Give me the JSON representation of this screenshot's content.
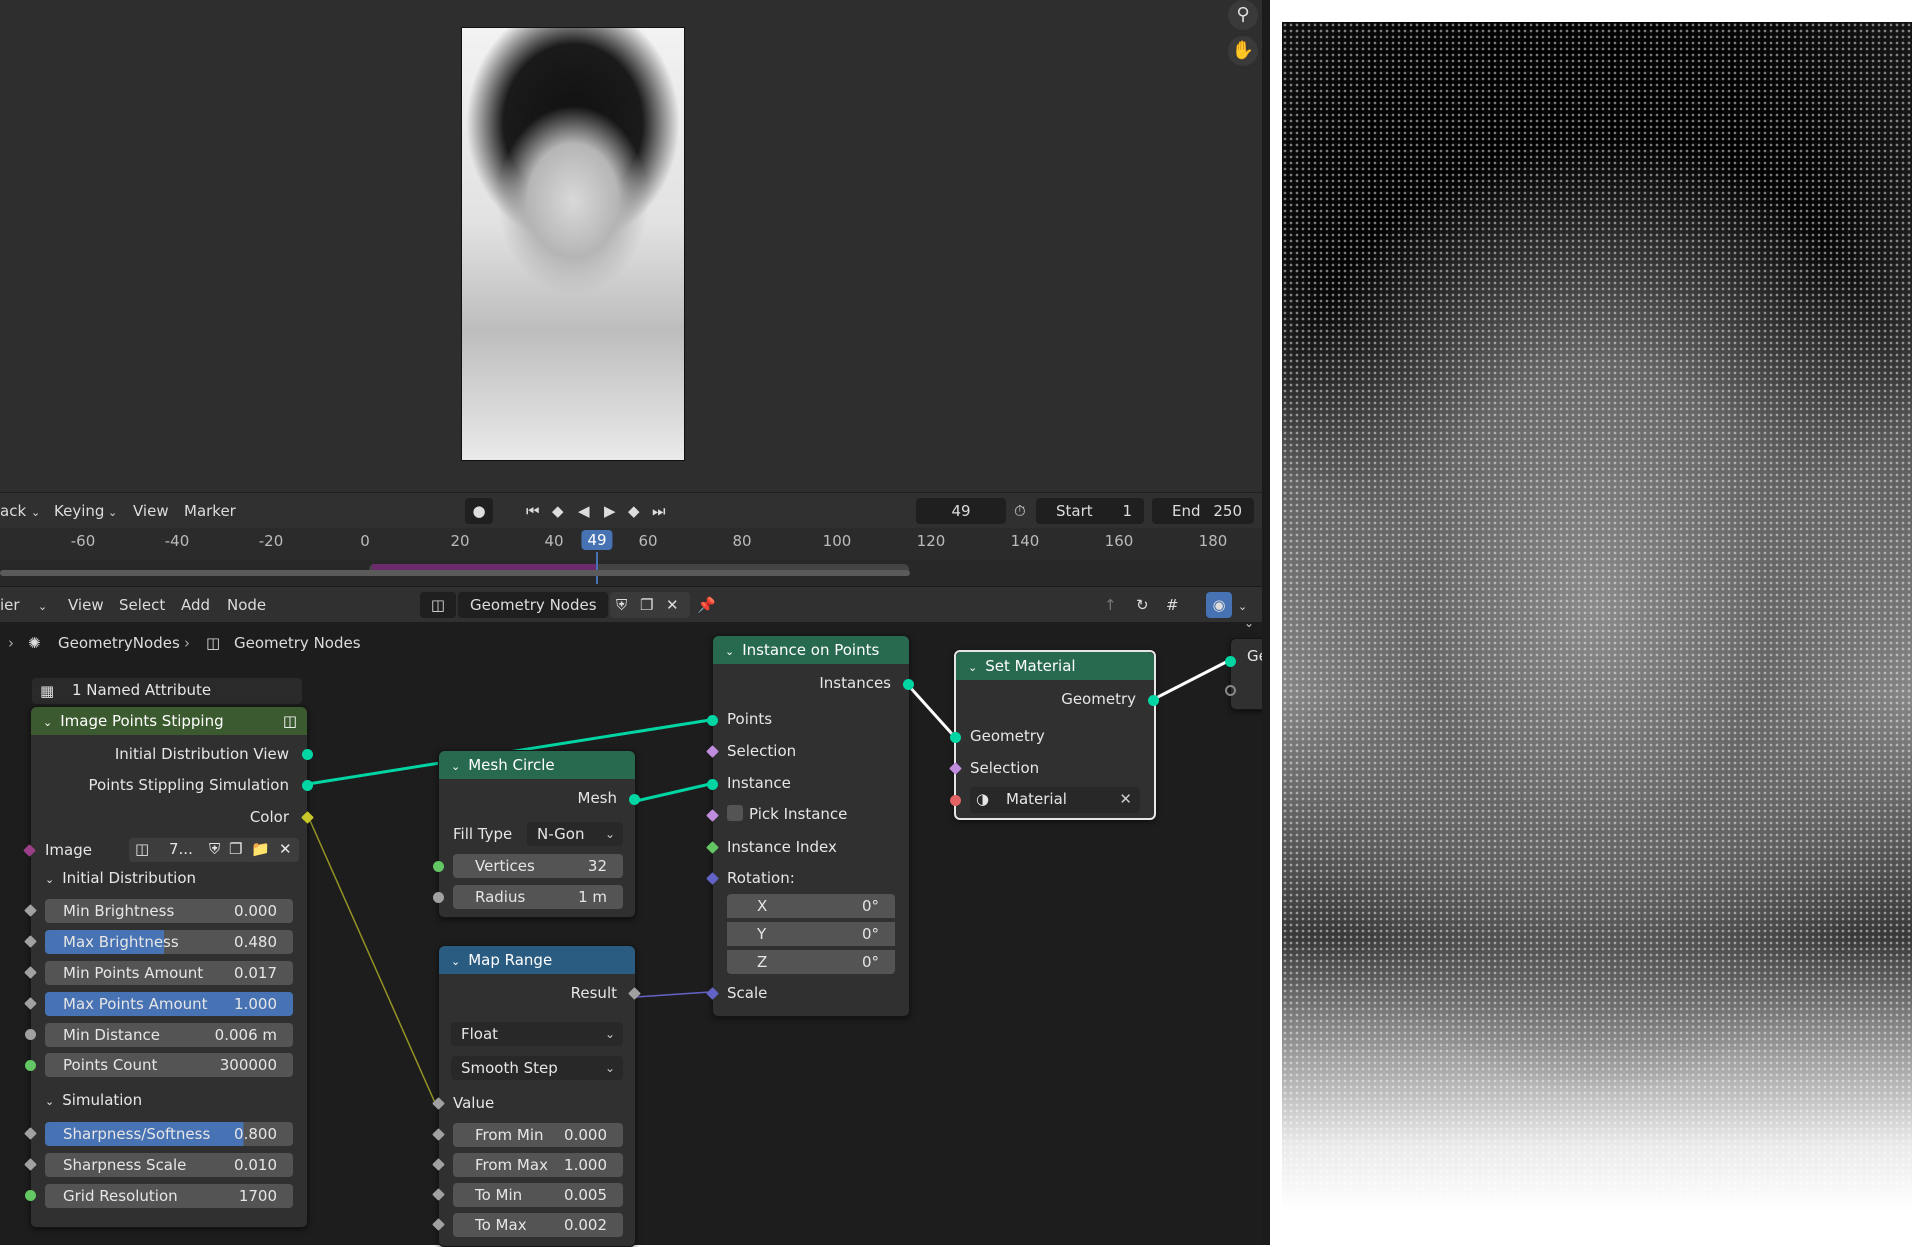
{
  "image_editor": {
    "zoom_icon": "zoom-in-icon",
    "pan_icon": "hand-icon"
  },
  "timeline": {
    "menus": [
      "ack",
      "Keying",
      "View",
      "Marker"
    ],
    "current_frame": "49",
    "start_label": "Start",
    "start_value": "1",
    "end_label": "End",
    "end_value": "250",
    "ticks": [
      "-60",
      "-40",
      "-20",
      "0",
      "20",
      "40",
      "49",
      "60",
      "80",
      "100",
      "120",
      "140",
      "160",
      "180"
    ]
  },
  "node_editor": {
    "header": {
      "editor_type": "ier",
      "menus": [
        "View",
        "Select",
        "Add",
        "Node"
      ],
      "node_tree_name": "Geometry Nodes"
    },
    "breadcrumb": [
      "GeometryNodes",
      "Geometry Nodes"
    ],
    "named_attribute_label": "1 Named Attribute",
    "group_node": {
      "title": "Image Points Stipping",
      "outputs": [
        "Initial Distribution View",
        "Points Stippling Simulation",
        "Color"
      ],
      "image_label": "Image",
      "image_value": "7...",
      "panel_initial": "Initial Distribution",
      "panel_simulation": "Simulation",
      "initial_fields": [
        {
          "label": "Min Brightness",
          "value": "0.000"
        },
        {
          "label": "Max Brightness",
          "value": "0.480"
        },
        {
          "label": "Min Points Amount",
          "value": "0.017"
        },
        {
          "label": "Max Points Amount",
          "value": "1.000"
        },
        {
          "label": "Min Distance",
          "value": "0.006 m"
        },
        {
          "label": "Points Count",
          "value": "300000"
        }
      ],
      "simulation_fields": [
        {
          "label": "Sharpness/Softness",
          "value": "0.800"
        },
        {
          "label": "Sharpness Scale",
          "value": "0.010"
        },
        {
          "label": "Grid Resolution",
          "value": "1700"
        }
      ]
    },
    "mesh_circle": {
      "title": "Mesh Circle",
      "output": "Mesh",
      "fill_type_label": "Fill Type",
      "fill_type_value": "N-Gon",
      "vertices_label": "Vertices",
      "vertices_value": "32",
      "radius_label": "Radius",
      "radius_value": "1 m"
    },
    "map_range": {
      "title": "Map Range",
      "output": "Result",
      "data_type": "Float",
      "interpolation": "Smooth Step",
      "value_label": "Value",
      "fields": [
        {
          "label": "From Min",
          "value": "0.000"
        },
        {
          "label": "From Max",
          "value": "1.000"
        },
        {
          "label": "To Min",
          "value": "0.005"
        },
        {
          "label": "To Max",
          "value": "0.002"
        }
      ]
    },
    "instance_on_points": {
      "title": "Instance on Points",
      "output": "Instances",
      "inputs": [
        "Points",
        "Selection",
        "Instance",
        "Pick Instance",
        "Instance Index",
        "Rotation:"
      ],
      "rotation": [
        {
          "label": "X",
          "value": "0°"
        },
        {
          "label": "Y",
          "value": "0°"
        },
        {
          "label": "Z",
          "value": "0°"
        }
      ],
      "scale_label": "Scale"
    },
    "set_material": {
      "title": "Set Material",
      "output": "Geometry",
      "inputs": [
        "Geometry",
        "Selection"
      ],
      "material_label": "Material"
    },
    "group_output_partial": "Ge"
  }
}
